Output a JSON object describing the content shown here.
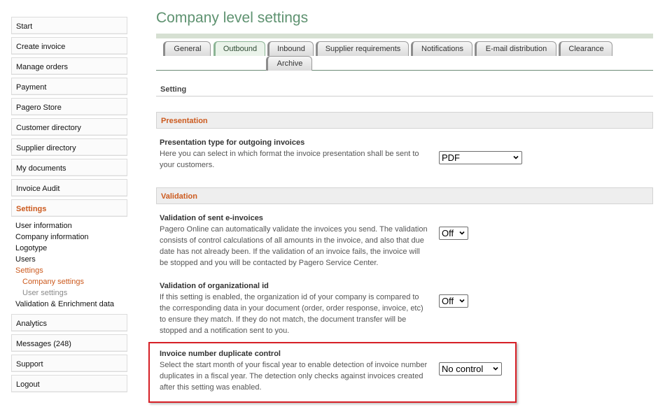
{
  "sidebar": {
    "items_top": [
      {
        "label": "Start"
      },
      {
        "label": "Create invoice"
      },
      {
        "label": "Manage orders"
      },
      {
        "label": "Payment"
      },
      {
        "label": "Pagero Store"
      },
      {
        "label": "Customer directory"
      },
      {
        "label": "Supplier directory"
      },
      {
        "label": "My documents"
      },
      {
        "label": "Invoice Audit"
      },
      {
        "label": "Settings"
      }
    ],
    "subnav": [
      {
        "label": "User information"
      },
      {
        "label": "Company information"
      },
      {
        "label": "Logotype"
      },
      {
        "label": "Users"
      },
      {
        "label": "Settings"
      },
      {
        "label": "Company settings"
      },
      {
        "label": "User settings"
      },
      {
        "label": "Validation & Enrichment data"
      }
    ],
    "items_bottom": [
      {
        "label": "Analytics"
      },
      {
        "label": "Messages (248)"
      },
      {
        "label": "Support"
      },
      {
        "label": "Logout"
      }
    ]
  },
  "page": {
    "title": "Company level settings"
  },
  "tabs": [
    {
      "label": "General"
    },
    {
      "label": "Outbound"
    },
    {
      "label": "Inbound"
    },
    {
      "label": "Supplier requirements"
    },
    {
      "label": "Notifications"
    },
    {
      "label": "E-mail distribution"
    },
    {
      "label": "Clearance"
    },
    {
      "label": "Archive"
    }
  ],
  "setting_label": "Setting",
  "sections": {
    "presentation": {
      "header": "Presentation",
      "row": {
        "title": "Presentation type for outgoing invoices",
        "desc": "Here you can select in which format the invoice presentation shall be sent to your customers.",
        "value": "PDF"
      }
    },
    "validation": {
      "header": "Validation",
      "rows": [
        {
          "title": "Validation of sent e-invoices",
          "desc": "Pagero Online can automatically validate the invoices you send. The validation consists of control calculations of all amounts in the invoice, and also that due date has not already been. If the validation of an invoice fails, the invoice will be stopped and you will be contacted by Pagero Service Center.",
          "value": "Off"
        },
        {
          "title": "Validation of organizational id",
          "desc": "If this setting is enabled, the organization id of your company is compared to the corresponding data in your document (order, order response, invoice, etc) to ensure they match. If they do not match, the document transfer will be stopped and a notification sent to you.",
          "value": "Off"
        },
        {
          "title": "Invoice number duplicate control",
          "desc": "Select the start month of your fiscal year to enable detection of invoice number duplicates in a fiscal year. The detection only checks against invoices created after this setting was enabled.",
          "value": "No control"
        }
      ]
    }
  },
  "colors": {
    "accent": "#cc5a1e",
    "title": "#5e9270",
    "highlight": "#d61f26"
  },
  "icons": {
    "select": "chevron-down-icon"
  }
}
